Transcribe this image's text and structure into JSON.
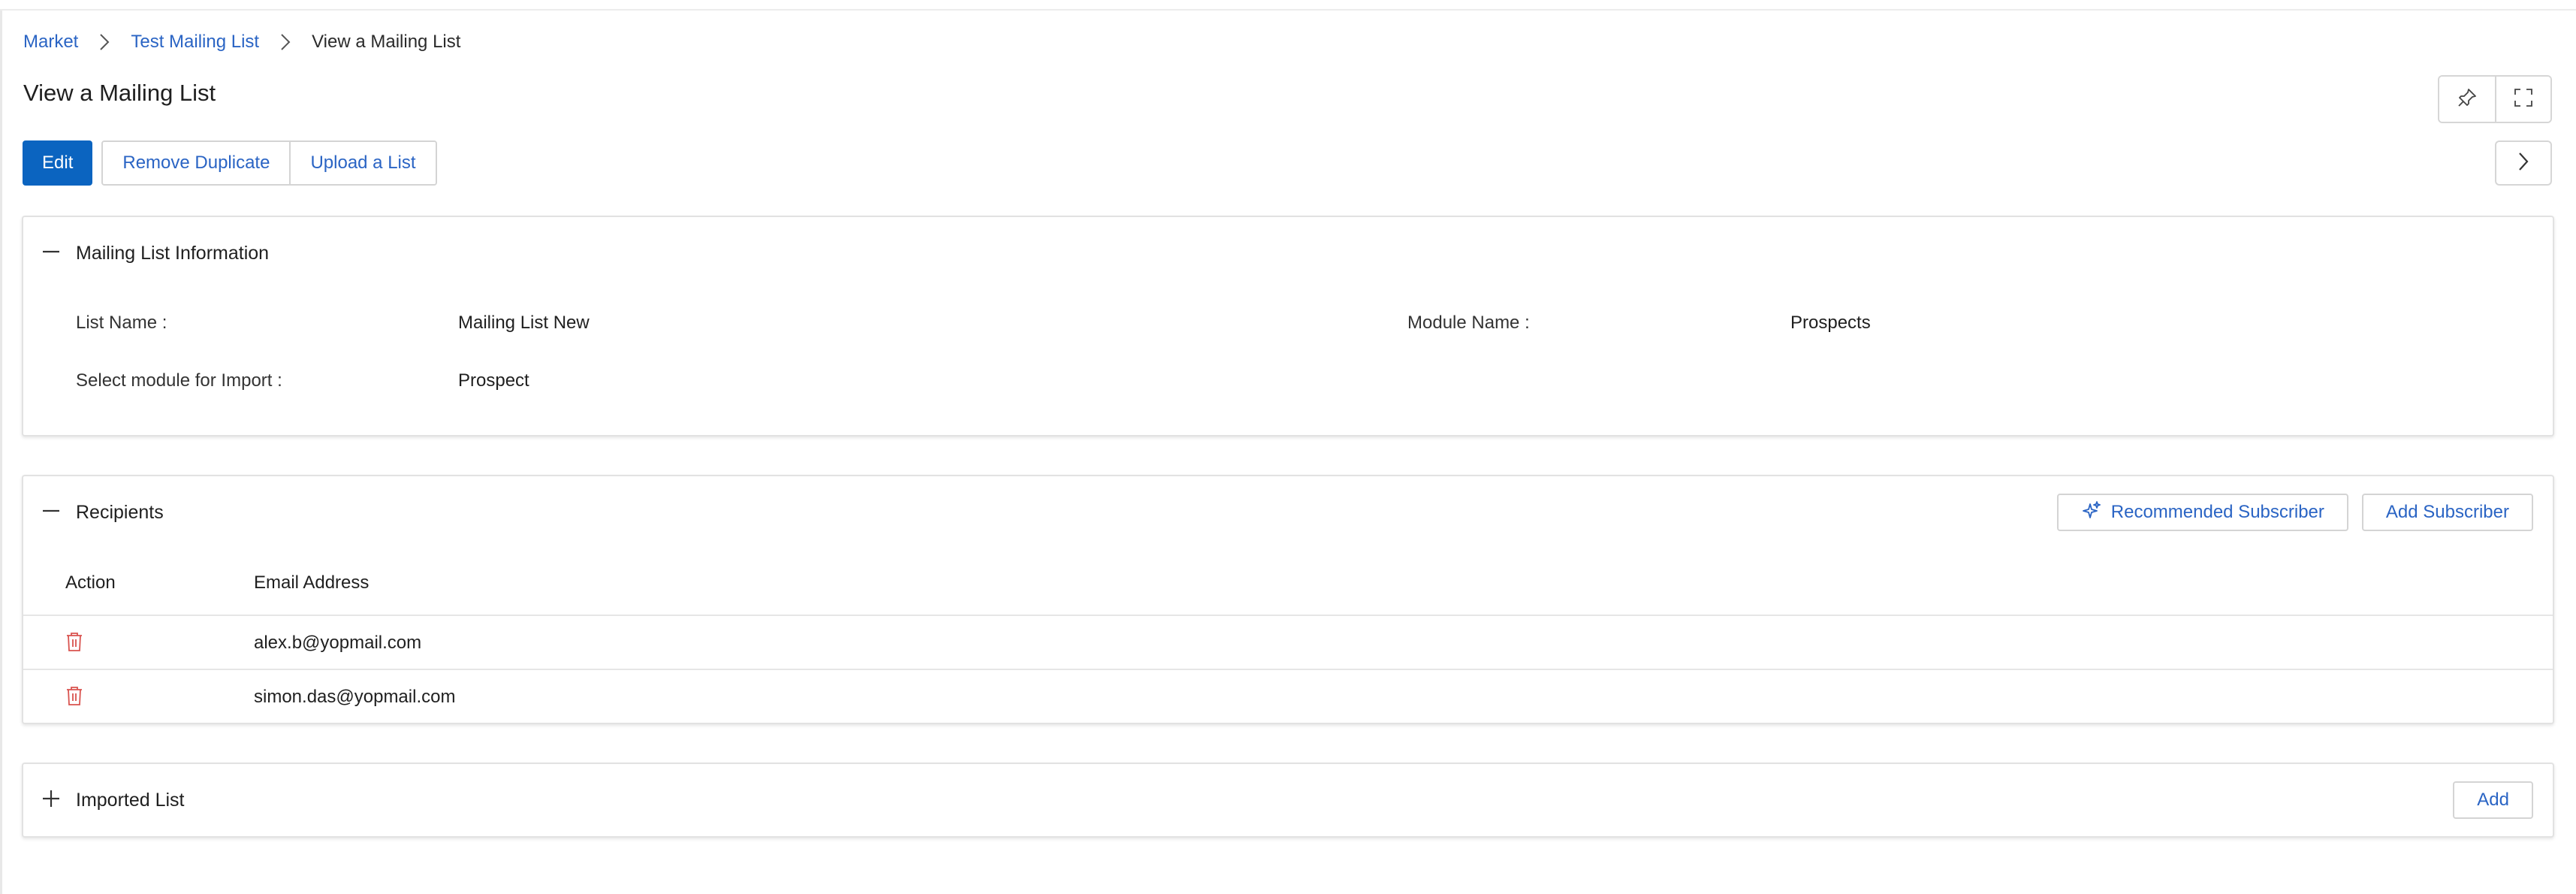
{
  "breadcrumb": {
    "items": [
      "Market",
      "Test Mailing List"
    ],
    "current": "View a Mailing List"
  },
  "page": {
    "title": "View a Mailing List"
  },
  "toolbar": {
    "edit_label": "Edit",
    "remove_duplicate_label": "Remove Duplicate",
    "upload_list_label": "Upload a List"
  },
  "icons": {
    "pin": "pin-icon",
    "fullscreen": "fullscreen-icon",
    "next": "chevron-right-icon",
    "collapse": "minus-icon",
    "expand": "plus-icon",
    "sparkle": "sparkle-icon",
    "delete": "trash-icon"
  },
  "mailing_info": {
    "title": "Mailing List Information",
    "list_name_label": "List Name :",
    "list_name_value": "Mailing List New",
    "module_name_label": "Module Name :",
    "module_name_value": "Prospects",
    "import_module_label": "Select module for Import :",
    "import_module_value": "Prospect"
  },
  "recipients": {
    "title": "Recipients",
    "recommended_label": "Recommended Subscriber",
    "add_subscriber_label": "Add Subscriber",
    "columns": [
      "Action",
      "Email Address"
    ],
    "rows": [
      {
        "email": "alex.b@yopmail.com"
      },
      {
        "email": "simon.das@yopmail.com"
      }
    ]
  },
  "imported": {
    "title": "Imported List",
    "add_label": "Add"
  },
  "colors": {
    "primary": "#0b64c0",
    "link": "#2a64c4",
    "delete": "#d9534f",
    "border": "#d4d4d4"
  }
}
